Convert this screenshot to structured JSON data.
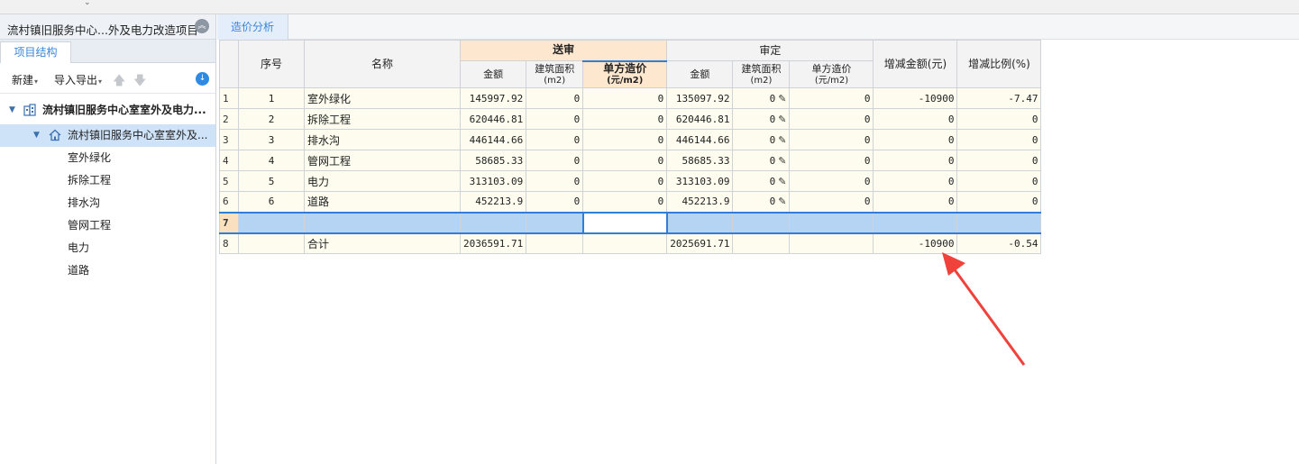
{
  "project": {
    "title": "流村镇旧服务中心...外及电力改造项目",
    "panel_tab": "项目结构"
  },
  "toolbar": {
    "new_label": "新建",
    "import_export_label": "导入导出"
  },
  "tree": {
    "root": "流村镇旧服务中心室室外及电力...",
    "child": "流村镇旧服务中心室室外及...",
    "leaves": [
      "室外绿化",
      "拆除工程",
      "排水沟",
      "管网工程",
      "电力",
      "道路"
    ]
  },
  "content_tab": "造价分析",
  "table": {
    "headers": {
      "seq": "序号",
      "name": "名称",
      "submitted": "送审",
      "approved": "审定",
      "diff_amount": "增减金额(元)",
      "diff_ratio": "增减比例(%)",
      "amount": "金额",
      "area": "建筑面积",
      "area_unit": "(m2)",
      "unit_cost": "单方造价",
      "unit_cost_unit": "(元/m2)"
    },
    "rows": [
      {
        "rn": "1",
        "seq": "1",
        "name": "室外绿化",
        "s_amount": "145997.92",
        "s_area": "0",
        "s_unit": "0",
        "a_amount": "135097.92",
        "a_area": "0",
        "a_unit": "0",
        "diff": "-10900",
        "ratio": "-7.47"
      },
      {
        "rn": "2",
        "seq": "2",
        "name": "拆除工程",
        "s_amount": "620446.81",
        "s_area": "0",
        "s_unit": "0",
        "a_amount": "620446.81",
        "a_area": "0",
        "a_unit": "0",
        "diff": "0",
        "ratio": "0"
      },
      {
        "rn": "3",
        "seq": "3",
        "name": "排水沟",
        "s_amount": "446144.66",
        "s_area": "0",
        "s_unit": "0",
        "a_amount": "446144.66",
        "a_area": "0",
        "a_unit": "0",
        "diff": "0",
        "ratio": "0"
      },
      {
        "rn": "4",
        "seq": "4",
        "name": "管网工程",
        "s_amount": "58685.33",
        "s_area": "0",
        "s_unit": "0",
        "a_amount": "58685.33",
        "a_area": "0",
        "a_unit": "0",
        "diff": "0",
        "ratio": "0"
      },
      {
        "rn": "5",
        "seq": "5",
        "name": "电力",
        "s_amount": "313103.09",
        "s_area": "0",
        "s_unit": "0",
        "a_amount": "313103.09",
        "a_area": "0",
        "a_unit": "0",
        "diff": "0",
        "ratio": "0"
      },
      {
        "rn": "6",
        "seq": "6",
        "name": "道路",
        "s_amount": "452213.9",
        "s_area": "0",
        "s_unit": "0",
        "a_amount": "452213.9",
        "a_area": "0",
        "a_unit": "0",
        "diff": "0",
        "ratio": "0"
      }
    ],
    "selected_row_number": "7",
    "total": {
      "rn": "8",
      "name": "合计",
      "s_amount": "2036591.71",
      "a_amount": "2025691.71",
      "diff": "-10900",
      "ratio": "-0.54"
    }
  },
  "colors": {
    "accent": "#3a86d8",
    "selection": "#b5d3f3",
    "header_highlight": "#fde7cf",
    "annotation_arrow": "#f0413b"
  },
  "icons": [
    "collapse-up-icon",
    "building-icon",
    "home-icon",
    "arrow-up-icon",
    "arrow-down-icon",
    "download-icon",
    "pencil-icon",
    "annotation-arrow"
  ]
}
